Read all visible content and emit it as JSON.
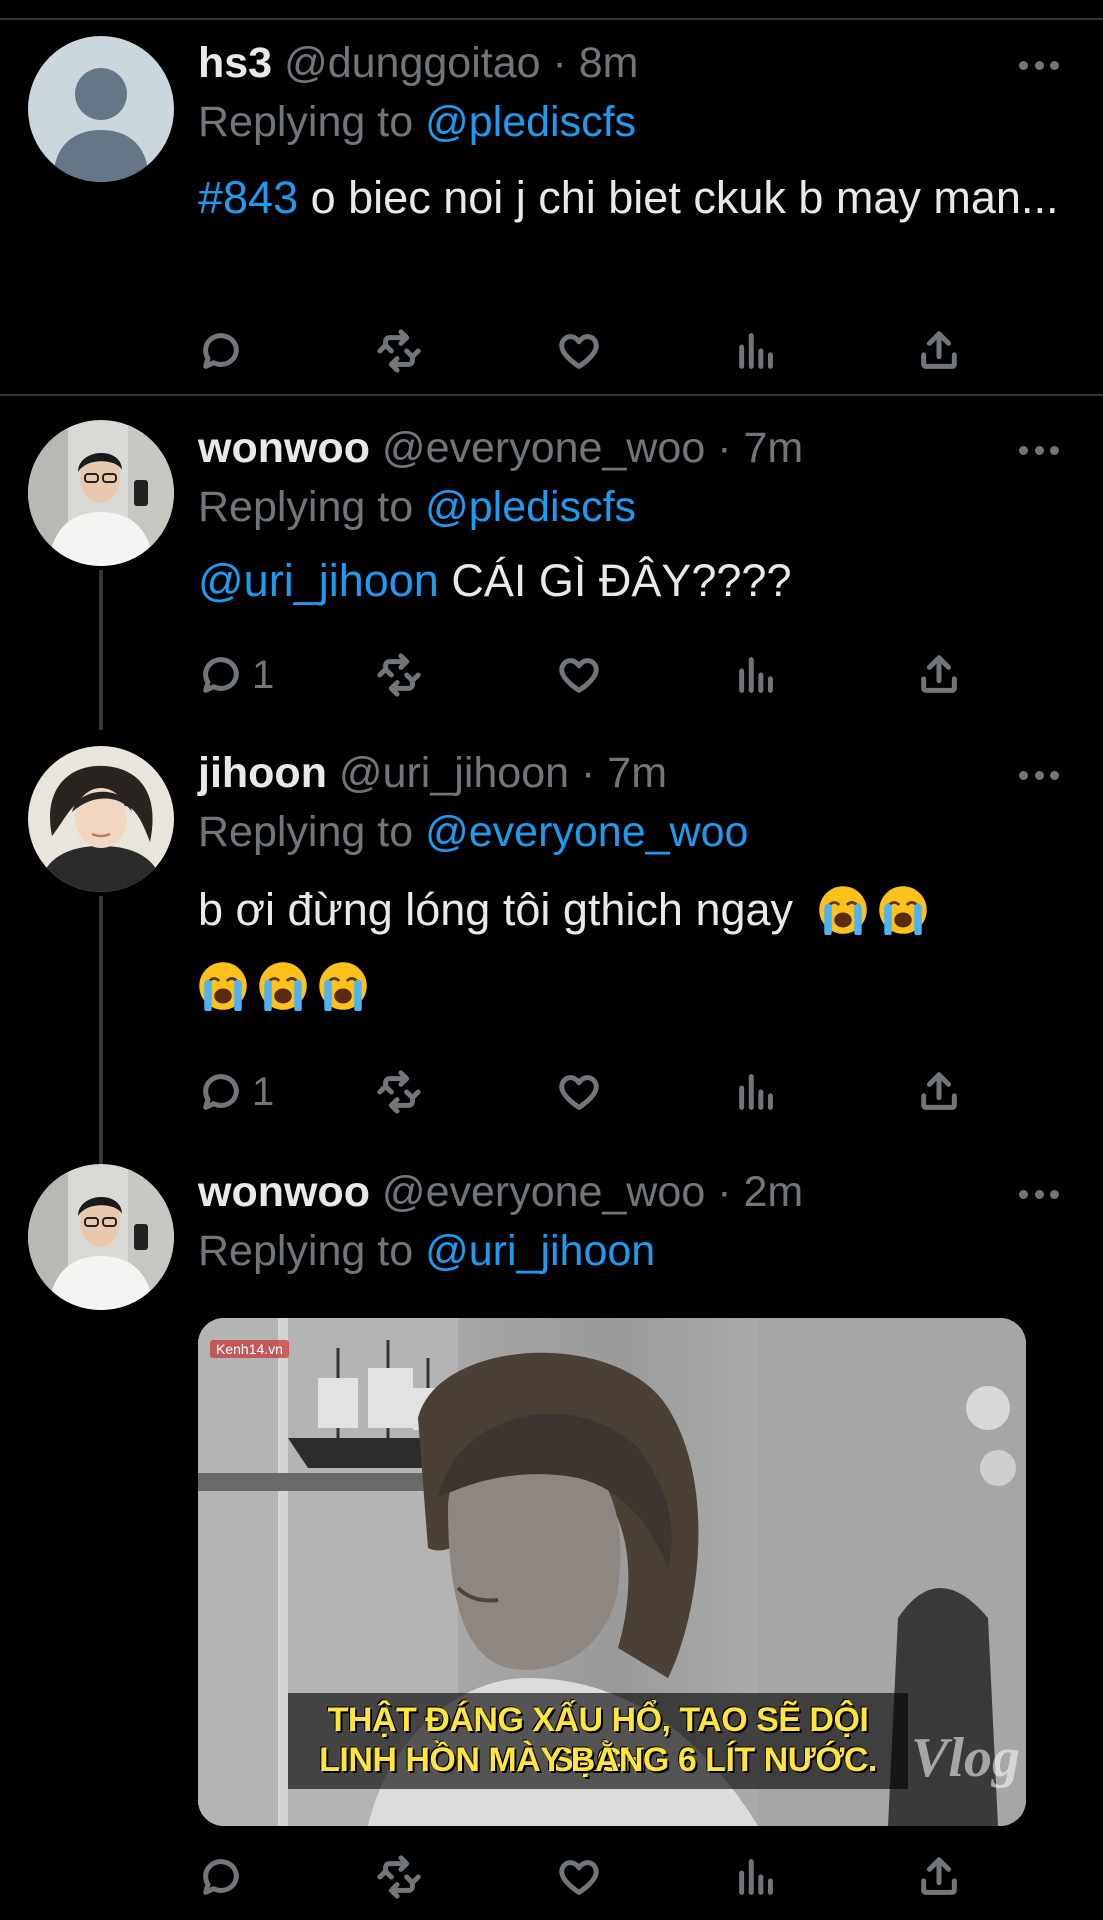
{
  "tweets": [
    {
      "name": "hs3",
      "handle": "@dunggoitao",
      "dot": "·",
      "time": "8m",
      "replying_prefix": "Replying to",
      "replying_to": "@plediscfs",
      "hashtag": "#843",
      "text": " o biec noi j chi biet ckuk b may man...",
      "reply_count": "",
      "avatar": "default-avatar-icon"
    },
    {
      "name": "wonwoo",
      "handle": "@everyone_woo",
      "dot": "·",
      "time": "7m",
      "replying_prefix": "Replying to",
      "replying_to": "@plediscfs",
      "mention": "@uri_jihoon",
      "text": " CÁI GÌ ĐÂY????",
      "reply_count": "1"
    },
    {
      "name": "jihoon",
      "handle": "@uri_jihoon",
      "dot": "·",
      "time": "7m",
      "replying_prefix": "Replying to",
      "replying_to": "@everyone_woo",
      "text": "b ơi đừng lóng tôi gthich ngay",
      "emojis": [
        "loudly-crying-face",
        "loudly-crying-face",
        "loudly-crying-face",
        "loudly-crying-face",
        "loudly-crying-face"
      ],
      "reply_count": "1"
    },
    {
      "name": "wonwoo",
      "handle": "@everyone_woo",
      "dot": "·",
      "time": "2m",
      "replying_prefix": "Replying to",
      "replying_to": "@uri_jihoon",
      "media": {
        "watermark": "Kenh14.vn",
        "subtitle_line1": "THẬT ĐÁNG XẤU HỔ, TAO SẼ DỘI SẠCH",
        "subtitle_line2": "LINH HỒN MÀY BẰNG 6 LÍT NƯỚC.",
        "corner_logo": "Vlog"
      },
      "reply_count": ""
    }
  ],
  "icons": {
    "reply": "reply-bubble-icon",
    "retweet": "retweet-icon",
    "like": "heart-icon",
    "views": "analytics-bars-icon",
    "share": "share-upload-icon",
    "more": "more-dots-icon"
  },
  "colors": {
    "background": "#000000",
    "text": "#e7e9ea",
    "muted": "#71767b",
    "accent": "#1d9bf0",
    "divider": "#2f3336"
  }
}
